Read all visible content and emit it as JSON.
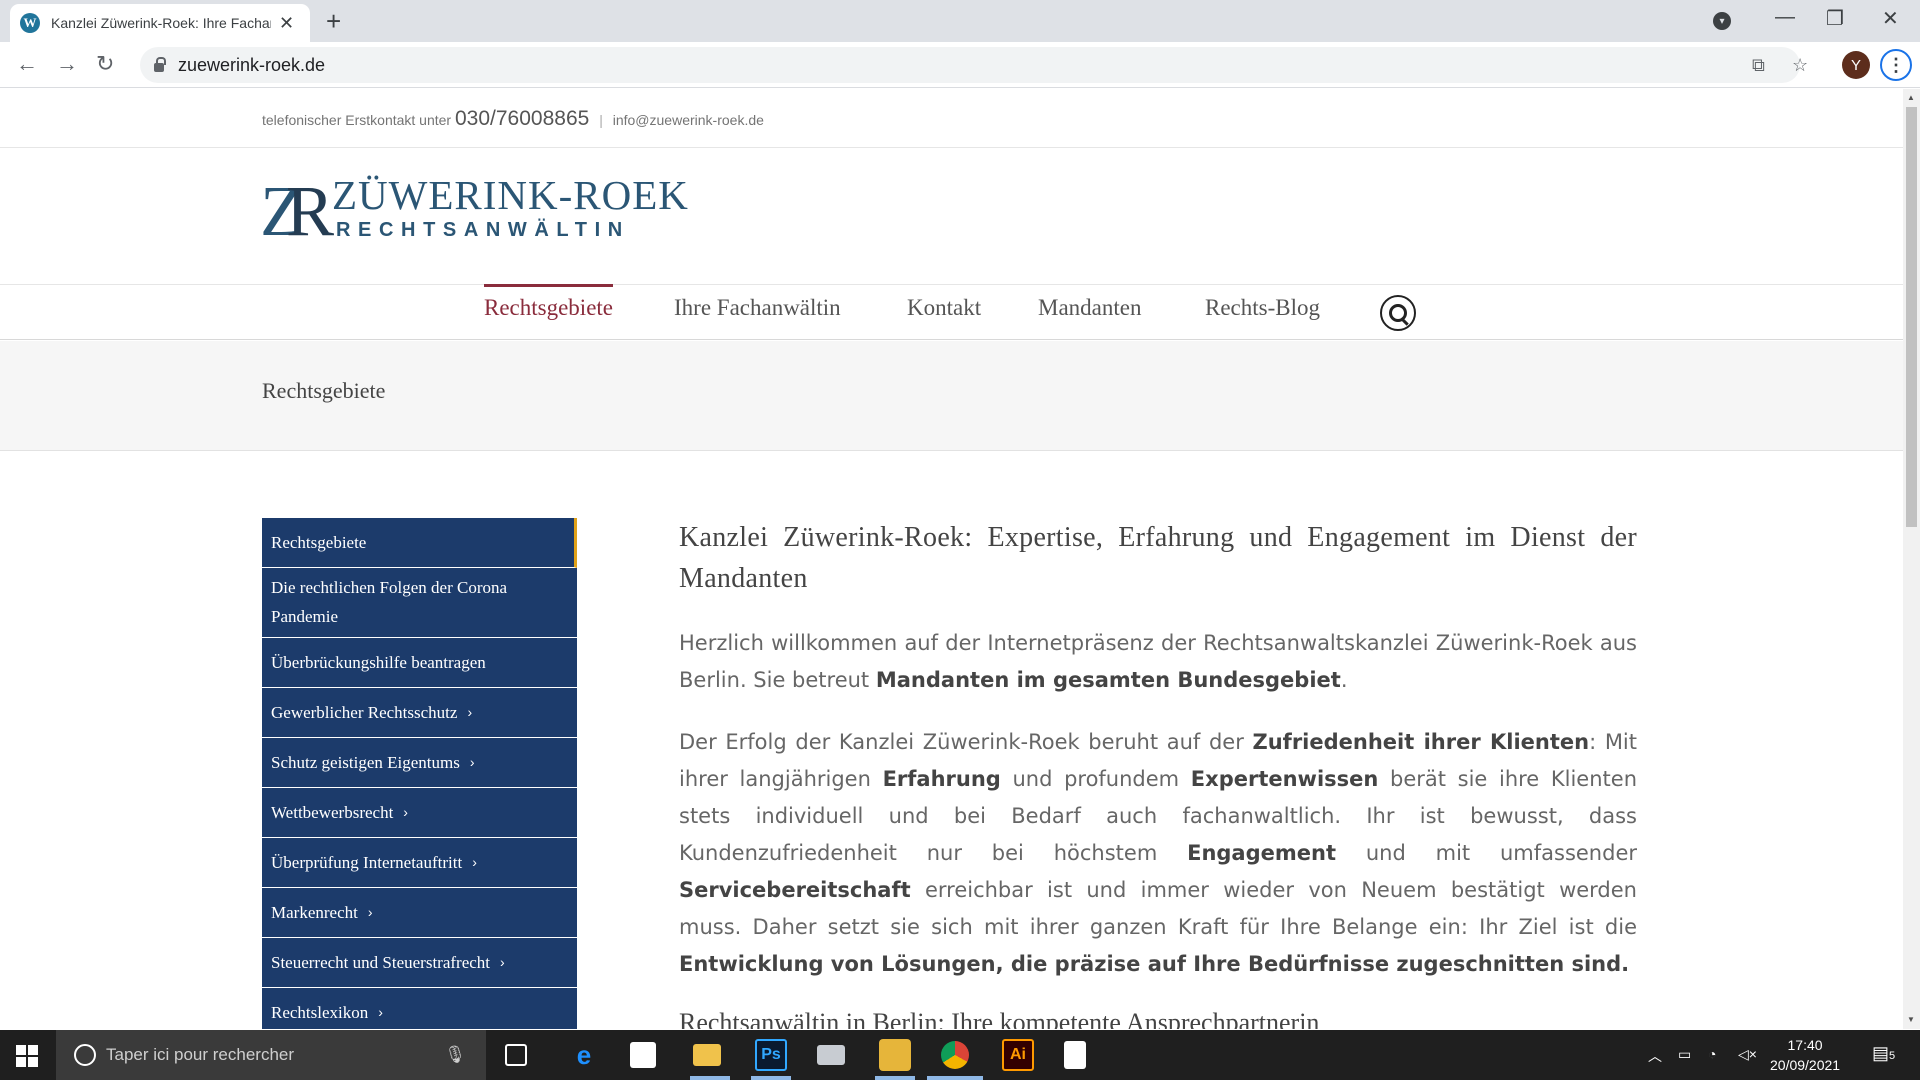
{
  "browser": {
    "tab_title": "Kanzlei Züwerink-Roek: Ihre Fachanwältin",
    "tab_favicon": "wordpress-icon",
    "url": "zuewerink-roek.de",
    "profile_initial": "Y"
  },
  "site": {
    "contact_prefix": "telefonischer Erstkontakt unter",
    "phone": "030/76008865",
    "separator": "|",
    "email": "info@zuewerink-roek.de",
    "logo_mono_z": "Z",
    "logo_mono_r": "R",
    "logo_name": "ZÜWERINK-ROEK",
    "logo_sub": "RECHTSANWÄLTIN",
    "accent_color": "#8a2c3c",
    "sidebar_color": "#1c3b6b"
  },
  "nav": {
    "items": [
      {
        "label": "Rechtsgebiete",
        "active": true
      },
      {
        "label": "Ihre Fachanwältin"
      },
      {
        "label": "Kontakt"
      },
      {
        "label": "Mandanten"
      },
      {
        "label": "Rechts-Blog"
      }
    ]
  },
  "page_title": "Rechtsgebiete",
  "sidebar": {
    "items": [
      {
        "label": "Rechtsgebiete",
        "chevron": ""
      },
      {
        "label": "Die rechtlichen Folgen der Corona Pandemie",
        "chevron": ""
      },
      {
        "label": "Überbrückungshilfe beantragen",
        "chevron": ""
      },
      {
        "label": "Gewerblicher Rechtsschutz",
        "chevron": "›"
      },
      {
        "label": "Schutz geistigen Eigentums",
        "chevron": "›"
      },
      {
        "label": "Wettbewerbsrecht",
        "chevron": "›"
      },
      {
        "label": "Überprüfung Internetauftritt",
        "chevron": "›"
      },
      {
        "label": "Markenrecht",
        "chevron": "›"
      },
      {
        "label": "Steuerrecht und Steuerstrafrecht",
        "chevron": "›"
      },
      {
        "label": "Rechtslexikon",
        "chevron": "›"
      }
    ]
  },
  "content": {
    "heading": "Kanzlei Züwerink-Roek: Expertise, Erfahrung und Engagement im Dienst der Mandanten",
    "p1_a": "Herzlich willkommen auf der Internetpräsenz der Rechtsanwaltskanzlei Züwerink-Roek aus Berlin. Sie betreut ",
    "p1_b": "Mandanten im gesamten Bundesgebiet",
    "p1_c": ".",
    "p2_a": "Der Erfolg der Kanzlei Züwerink-Roek beruht auf der ",
    "p2_b": "Zufriedenheit ihrer Klienten",
    "p2_c": ": Mit ihrer langjährigen ",
    "p2_d": "Erfahrung",
    "p2_e": " und profundem ",
    "p2_f": "Expertenwissen",
    "p2_g": " berät sie ihre Klienten stets individuell und bei Bedarf auch fachanwaltlich. Ihr ist bewusst, dass Kundenzufriedenheit nur bei höchstem ",
    "p2_h": "Engagement",
    "p2_i": " und mit umfassender ",
    "p2_j": "Servicebereitschaft",
    "p2_k": " erreichbar ist und immer wieder von Neuem bestätigt werden muss. Daher setzt sie sich mit ihrer ganzen Kraft für Ihre Belange ein: Ihr Ziel ist die ",
    "p2_l": "Entwicklung von Lösungen, die präzise auf Ihre Bedürfnisse zugeschnitten sind.",
    "cut_heading": "Rechtsanwältin in Berlin: Ihre kompetente Ansprechpartnerin"
  },
  "taskbar": {
    "search_placeholder": "Taper ici pour rechercher",
    "time": "17:40",
    "date": "20/09/2021",
    "notification_count": "5",
    "apps": [
      "task-view-icon",
      "edge-icon",
      "store-icon",
      "file-explorer-icon",
      "photoshop-icon",
      "printer-icon",
      "gallery-icon",
      "chrome-icon",
      "illustrator-icon",
      "calculator-icon"
    ],
    "ps_label": "Ps",
    "ai_label": "Ai"
  }
}
